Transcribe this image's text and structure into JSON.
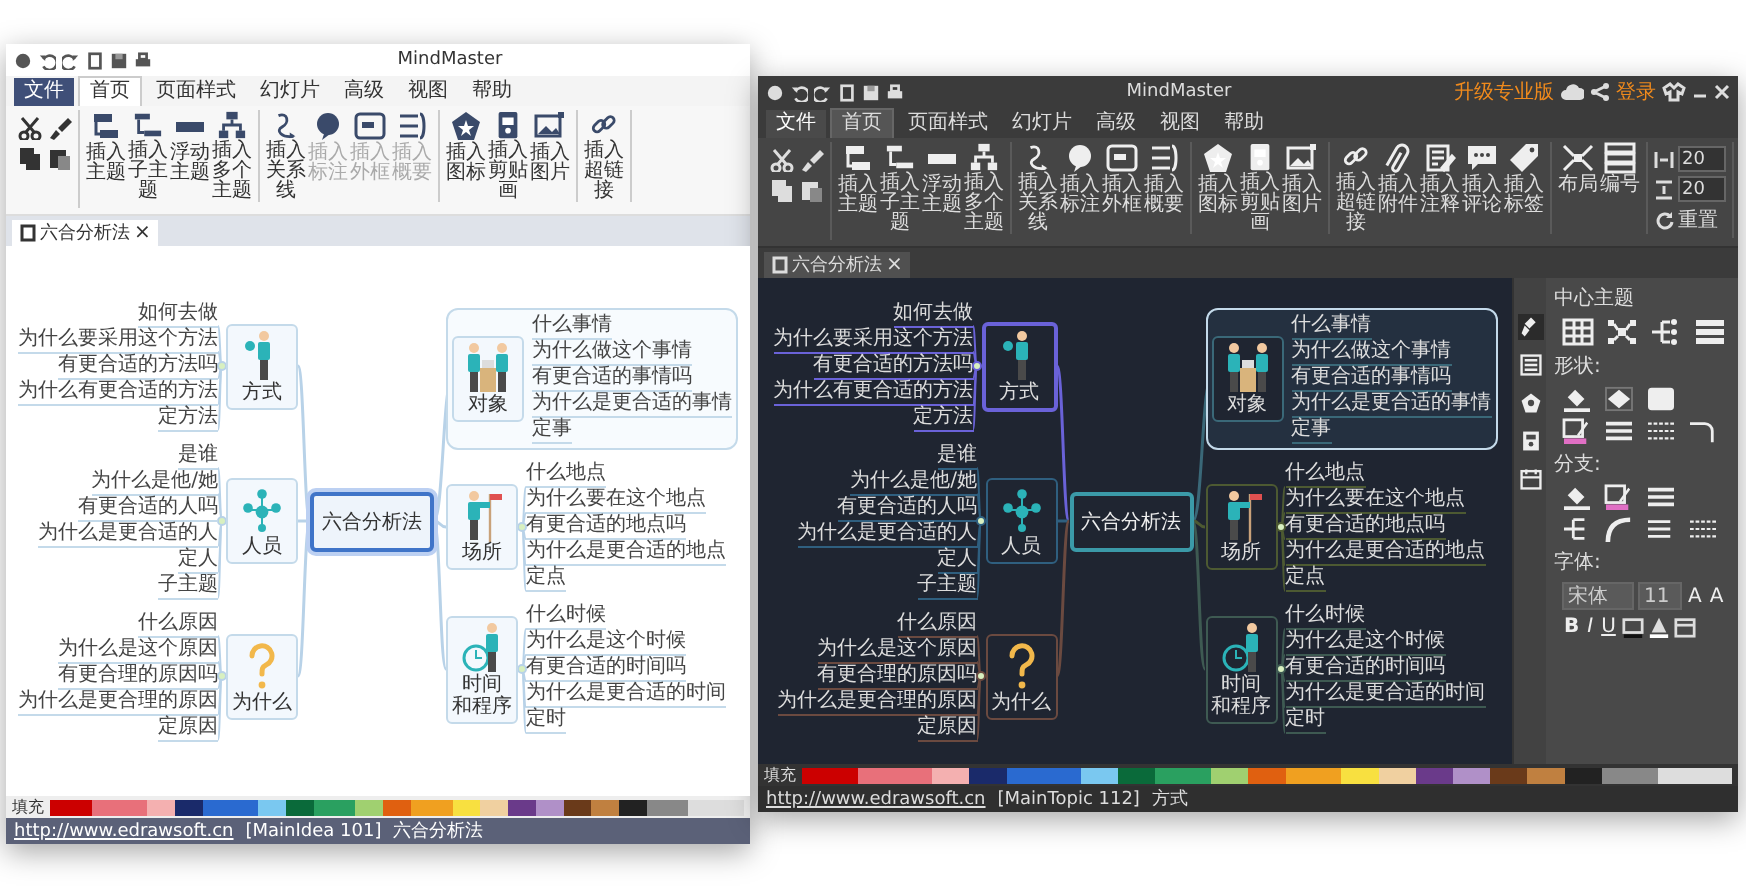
{
  "windows": [
    {
      "kind": "light",
      "title": "MindMaster",
      "menu_tabs": [
        {
          "label": "文件",
          "kind": "file",
          "selected": false
        },
        {
          "label": "首页",
          "kind": "tab",
          "selected": true
        },
        {
          "label": "页面样式",
          "kind": "tab",
          "selected": false
        },
        {
          "label": "幻灯片",
          "kind": "tab",
          "selected": false
        },
        {
          "label": "高级",
          "kind": "tab",
          "selected": false
        },
        {
          "label": "视图",
          "kind": "tab",
          "selected": false
        },
        {
          "label": "帮助",
          "kind": "tab",
          "selected": false
        }
      ],
      "ribbon": [
        {
          "kind": "clipboard"
        },
        {
          "kind": "buttons",
          "buttons": [
            {
              "label": "插入主题",
              "disabled": false
            },
            {
              "label": "插入子主题",
              "disabled": false
            },
            {
              "label": "浮动主题",
              "disabled": false
            },
            {
              "label": "插入多个主题",
              "disabled": false
            }
          ]
        },
        {
          "kind": "buttons",
          "buttons": [
            {
              "label": "插入关系线",
              "disabled": false
            },
            {
              "label": "插入标注",
              "disabled": true
            },
            {
              "label": "插入外框",
              "disabled": true
            },
            {
              "label": "插入概要",
              "disabled": true
            }
          ]
        },
        {
          "kind": "buttons",
          "buttons": [
            {
              "label": "插入图标",
              "disabled": false
            },
            {
              "label": "插入剪贴画",
              "disabled": false
            },
            {
              "label": "插入图片",
              "disabled": false
            }
          ]
        },
        {
          "kind": "buttons",
          "buttons": [
            {
              "label": "插入超链接",
              "disabled": false
            }
          ]
        }
      ],
      "doc_tab": {
        "label": "六合分析法",
        "close": "×"
      },
      "map": {
        "center": {
          "label": "六合分析法",
          "selected": true
        },
        "left": [
          {
            "title": [
              "方式"
            ],
            "selected": false,
            "boundary": false,
            "children": [
              "如何去做",
              "为什么要采用这个方法",
              "有更合适的方法吗",
              "为什么有更合适的方法",
              "定方法"
            ]
          },
          {
            "title": [
              "人员"
            ],
            "selected": false,
            "boundary": false,
            "children": [
              "是谁",
              "为什么是他/她",
              "有更合适的人吗",
              "为什么是更合适的人",
              "定人",
              "子主题"
            ]
          },
          {
            "title": [
              "为什么"
            ],
            "selected": false,
            "boundary": false,
            "children": [
              "什么原因",
              "为什么是这个原因",
              "有更合理的原因吗",
              "为什么是更合理的原因",
              "定原因"
            ]
          }
        ],
        "right": [
          {
            "title": [
              "对象"
            ],
            "selected": false,
            "boundary": true,
            "children": [
              "什么事情",
              "为什么做这个事情",
              "有更合适的事情吗",
              "为什么是更合适的事情",
              "定事"
            ]
          },
          {
            "title": [
              "场所"
            ],
            "selected": false,
            "boundary": false,
            "children": [
              "什么地点",
              "为什么要在这个地点",
              "有更合适的地点吗",
              "为什么是更合适的地点",
              "定点"
            ]
          },
          {
            "title": [
              "时间",
              "和程序"
            ],
            "selected": false,
            "boundary": false,
            "children": [
              "什么时候",
              "为什么是这个时候",
              "有更合适的时间吗",
              "为什么是更合适的时间",
              "定时"
            ]
          }
        ]
      },
      "palette": {
        "label": "填充"
      },
      "status": {
        "link": "http://www.edrawsoft.cn",
        "topic_id": "[MainIdea 101]",
        "topic_name": "六合分析法"
      }
    },
    {
      "kind": "dark",
      "title": "MindMaster",
      "account": {
        "upgrade": "升级专业版",
        "login": "登录"
      },
      "menu_tabs": [
        {
          "label": "文件",
          "kind": "file",
          "selected": false
        },
        {
          "label": "首页",
          "kind": "tab",
          "selected": true
        },
        {
          "label": "页面样式",
          "kind": "tab",
          "selected": false
        },
        {
          "label": "幻灯片",
          "kind": "tab",
          "selected": false
        },
        {
          "label": "高级",
          "kind": "tab",
          "selected": false
        },
        {
          "label": "视图",
          "kind": "tab",
          "selected": false
        },
        {
          "label": "帮助",
          "kind": "tab",
          "selected": false
        }
      ],
      "ribbon": [
        {
          "kind": "clipboard"
        },
        {
          "kind": "buttons",
          "buttons": [
            {
              "label": "插入主题",
              "disabled": false
            },
            {
              "label": "插入子主题",
              "disabled": false
            },
            {
              "label": "浮动主题",
              "disabled": false
            },
            {
              "label": "插入多个主题",
              "disabled": false
            }
          ]
        },
        {
          "kind": "buttons",
          "buttons": [
            {
              "label": "插入关系线",
              "disabled": false
            },
            {
              "label": "插入标注",
              "disabled": false
            },
            {
              "label": "插入外框",
              "disabled": false
            },
            {
              "label": "插入概要",
              "disabled": false
            }
          ]
        },
        {
          "kind": "buttons",
          "buttons": [
            {
              "label": "插入图标",
              "disabled": false
            },
            {
              "label": "插入剪贴画",
              "disabled": false
            },
            {
              "label": "插入图片",
              "disabled": false
            }
          ]
        },
        {
          "kind": "buttons",
          "buttons": [
            {
              "label": "插入超链接",
              "disabled": false
            },
            {
              "label": "插入附件",
              "disabled": false
            },
            {
              "label": "插入注释",
              "disabled": false
            },
            {
              "label": "插入评论",
              "disabled": false
            },
            {
              "label": "插入标签",
              "disabled": false
            }
          ]
        },
        {
          "kind": "buttons",
          "buttons": [
            {
              "label": "布局",
              "disabled": false
            },
            {
              "label": "编号",
              "disabled": false
            }
          ]
        },
        {
          "kind": "spinners",
          "fields": [
            {
              "value": "20"
            },
            {
              "value": "20"
            }
          ],
          "reset": "重置"
        }
      ],
      "doc_tab": {
        "label": "六合分析法",
        "close": "×"
      },
      "map": {
        "center": {
          "label": "六合分析法",
          "selected": false
        },
        "left": [
          {
            "title": [
              "方式"
            ],
            "selected": true,
            "boundary": false,
            "color": "#6a62d8",
            "children": [
              "如何去做",
              "为什么要采用这个方法",
              "有更合适的方法吗",
              "为什么有更合适的方法",
              "定方法"
            ]
          },
          {
            "title": [
              "人员"
            ],
            "selected": false,
            "boundary": false,
            "color": "#2f5f7f",
            "children": [
              "是谁",
              "为什么是他/她",
              "有更合适的人吗",
              "为什么是更合适的人",
              "定人",
              "子主题"
            ]
          },
          {
            "title": [
              "为什么"
            ],
            "selected": false,
            "boundary": false,
            "color": "#6b4a40",
            "children": [
              "什么原因",
              "为什么是这个原因",
              "有更合理的原因吗",
              "为什么是更合理的原因",
              "定原因"
            ]
          }
        ],
        "right": [
          {
            "title": [
              "对象"
            ],
            "selected": false,
            "boundary": true,
            "color": "#3a6878",
            "children": [
              "什么事情",
              "为什么做这个事情",
              "有更合适的事情吗",
              "为什么是更合适的事情",
              "定事"
            ]
          },
          {
            "title": [
              "场所"
            ],
            "selected": false,
            "boundary": false,
            "color": "#4d5a32",
            "children": [
              "什么地点",
              "为什么要在这个地点",
              "有更合适的地点吗",
              "为什么是更合适的地点",
              "定点"
            ]
          },
          {
            "title": [
              "时间",
              "和程序"
            ],
            "selected": false,
            "boundary": false,
            "color": "#3e5a52",
            "children": [
              "什么时候",
              "为什么是这个时候",
              "有更合适的时间吗",
              "为什么是更合适的时间",
              "定时"
            ]
          }
        ]
      },
      "panel": {
        "title": "中心主题",
        "side_tabs": [
          {
            "selected": true
          },
          {
            "selected": false
          },
          {
            "selected": false
          },
          {
            "selected": false
          },
          {
            "selected": false
          }
        ],
        "sections": [
          {
            "label": "形状:"
          },
          {
            "label": "分支:"
          },
          {
            "label": "字体:"
          }
        ],
        "font": "宋体",
        "size": "11",
        "size_buttons": [
          "A",
          "A"
        ],
        "format_buttons": [
          "B",
          "I",
          "U"
        ]
      },
      "palette": {
        "label": "填充"
      },
      "status": {
        "link": "http://www.edrawsoft.cn",
        "topic_id": "[MainTopic 112]",
        "topic_name": "方式"
      }
    }
  ]
}
